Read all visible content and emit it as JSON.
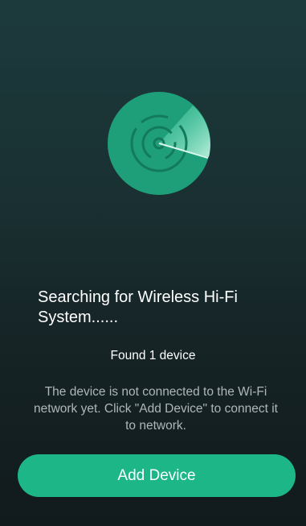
{
  "search": {
    "title": "Searching for Wireless Hi-Fi System......",
    "found_count": "Found 1 device",
    "hint": "The device is not connected to the Wi-Fi network yet. Click \"Add Device\" to connect it to network."
  },
  "actions": {
    "add_device_label": "Add Device"
  },
  "icons": {
    "radar": "radar-scan-icon"
  },
  "colors": {
    "accent": "#1db787",
    "radar_disc": "#1e9f79",
    "hint_text": "#aeb7b8"
  }
}
